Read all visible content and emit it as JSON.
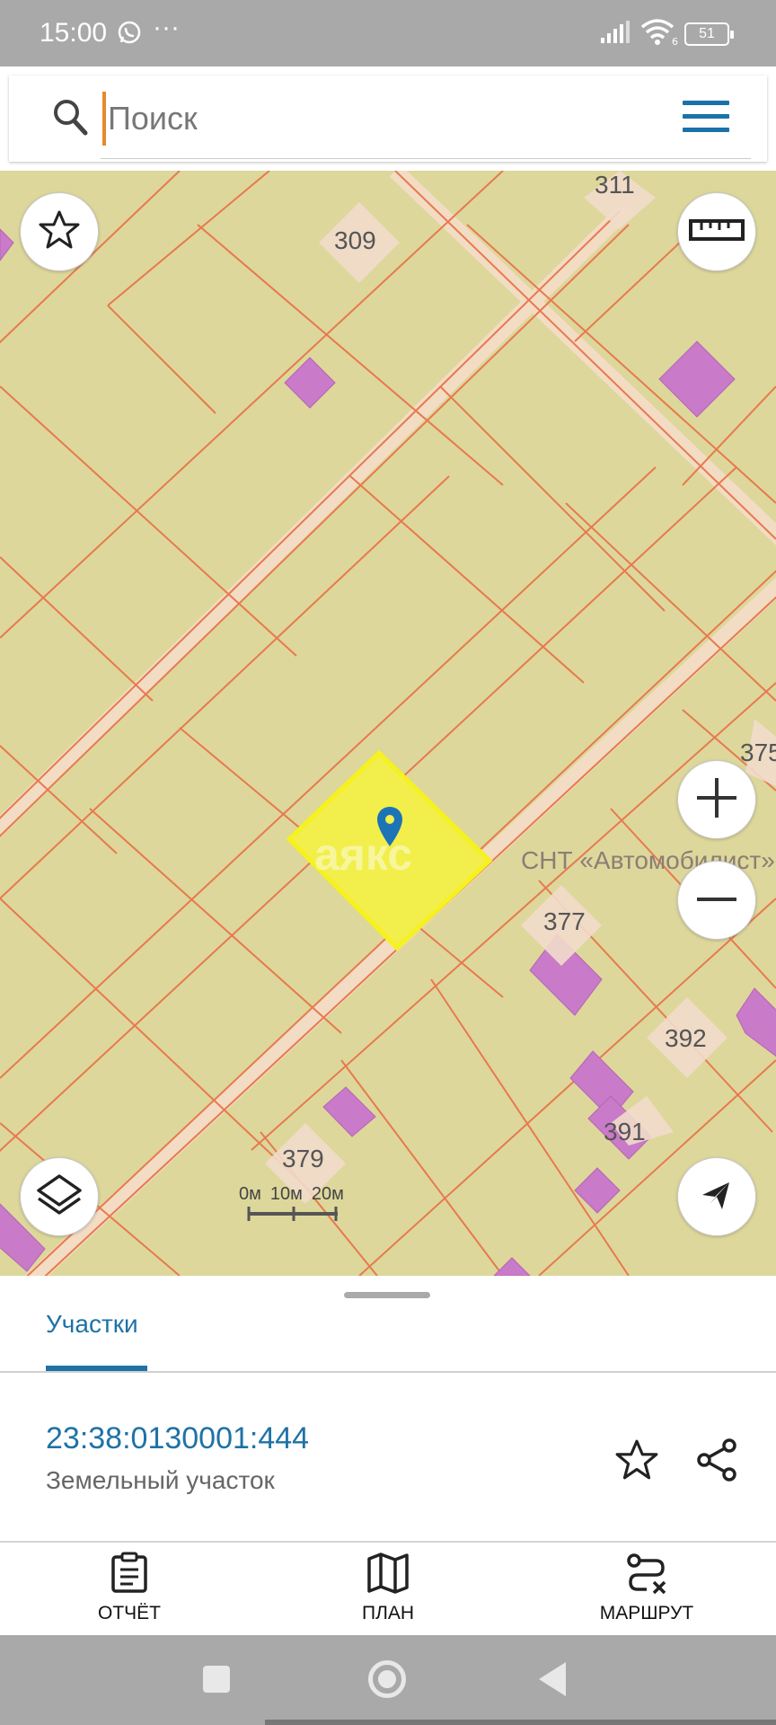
{
  "status_bar": {
    "time": "15:00",
    "dots": "···",
    "battery": "51",
    "wifi_badge": "6",
    "icons": [
      "whatsapp-icon",
      "signal-icon",
      "wifi-icon",
      "battery-icon"
    ]
  },
  "search": {
    "placeholder": "Поиск",
    "value": "",
    "icons": [
      "search-icon",
      "menu-icon"
    ]
  },
  "map": {
    "parcel_labels": [
      "311",
      "309",
      "375",
      "377",
      "392",
      "391",
      "379"
    ],
    "area_label": "СНТ «Автомобилист»",
    "watermark": "аякс",
    "scale_labels": [
      "0м",
      "10м",
      "20м"
    ],
    "buttons": [
      "favorites-star-icon",
      "ruler-icon",
      "zoom-in-icon",
      "zoom-out-icon",
      "layers-icon",
      "locate-arrow-icon"
    ],
    "colors": {
      "land": "#ddd79b",
      "boundary": "#e8794f",
      "building": "#c97ac8",
      "road": "#f3dcc4",
      "selected": "#f2ee4c",
      "selected_border": "#f5f21e",
      "marker": "#1c74b6"
    }
  },
  "sheet": {
    "tab_label": "Участки",
    "parcel_id": "23:38:0130001:444",
    "parcel_type": "Земельный участок"
  },
  "bottom_nav": {
    "report": "ОТЧЁТ",
    "plan": "ПЛАН",
    "route": "МАРШРУТ"
  },
  "colors": {
    "accent": "#1f72a6",
    "status_bar": "#a9a9a9",
    "cursor": "#e8892b"
  }
}
